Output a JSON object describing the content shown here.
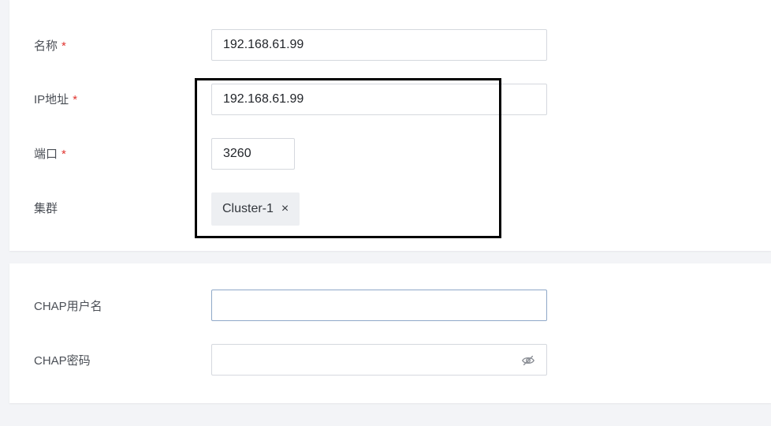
{
  "basic_section": {
    "name": {
      "label": "名称",
      "required_mark": "*",
      "value": "192.168.61.99"
    },
    "ip_address": {
      "label": "IP地址",
      "required_mark": "*",
      "value": "192.168.61.99"
    },
    "port": {
      "label": "端口",
      "required_mark": "*",
      "value": "3260"
    },
    "cluster": {
      "label": "集群",
      "tag": "Cluster-1",
      "tag_close": "×"
    }
  },
  "chap_section": {
    "username": {
      "label": "CHAP用户名",
      "value": ""
    },
    "password": {
      "label": "CHAP密码",
      "value": "",
      "toggle_icon": "eye-slash-icon"
    }
  },
  "colors": {
    "background": "#f3f4f7",
    "card": "#ffffff",
    "required": "#e0342f",
    "input_border": "#d5d8de",
    "focused_border": "#8fa8c8",
    "tag_background": "#edeff2",
    "highlight_box": "#000000"
  }
}
